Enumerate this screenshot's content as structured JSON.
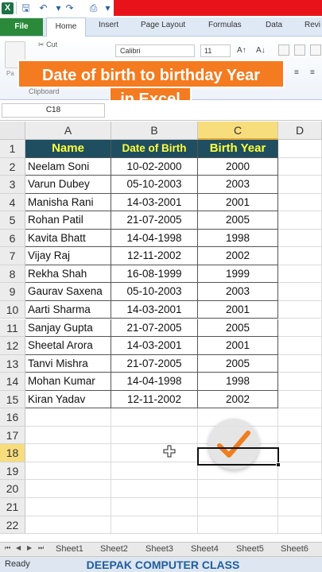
{
  "ribbon": {
    "tabs": [
      "File",
      "Home",
      "Insert",
      "Page Layout",
      "Formulas",
      "Data",
      "Revi"
    ],
    "cut_label": "Cut",
    "font_name": "Calibri",
    "font_size": "11",
    "clipboard_label": "Clipboard",
    "paste_label": "Pa"
  },
  "overlay": {
    "line1": "Date of birth to birthday Year",
    "line2": "in Excel"
  },
  "formula_bar": {
    "name_box": "C18"
  },
  "grid": {
    "columns": [
      "A",
      "B",
      "C",
      "D"
    ],
    "rows": [
      "1",
      "2",
      "3",
      "4",
      "5",
      "6",
      "7",
      "8",
      "9",
      "10",
      "11",
      "12",
      "13",
      "14",
      "15",
      "16",
      "17",
      "18",
      "19",
      "20",
      "21",
      "22"
    ],
    "headers": [
      "Name",
      "Date of Birth",
      "Birth Year"
    ],
    "data": [
      [
        "Neelam Soni",
        "10-02-2000",
        "2000"
      ],
      [
        "Varun Dubey",
        "05-10-2003",
        "2003"
      ],
      [
        "Manisha Rani",
        "14-03-2001",
        "2001"
      ],
      [
        "Rohan Patil",
        "21-07-2005",
        "2005"
      ],
      [
        "Kavita Bhatt",
        "14-04-1998",
        "1998"
      ],
      [
        "Vijay Raj",
        "12-11-2002",
        "2002"
      ],
      [
        "Rekha Shah",
        "16-08-1999",
        "1999"
      ],
      [
        "Gaurav Saxena",
        "05-10-2003",
        "2003"
      ],
      [
        "Aarti Sharma",
        "14-03-2001",
        "2001"
      ],
      [
        "Sanjay Gupta",
        "21-07-2005",
        "2005"
      ],
      [
        "Sheetal Arora",
        "14-03-2001",
        "2001"
      ],
      [
        "Tanvi Mishra",
        "21-07-2005",
        "2005"
      ],
      [
        "Mohan Kumar",
        "14-04-1998",
        "1998"
      ],
      [
        "Kiran Yadav",
        "12-11-2002",
        "2002"
      ]
    ],
    "selected_column": "C",
    "selected_row": "18"
  },
  "sheets": [
    "Sheet1",
    "Sheet2",
    "Sheet3",
    "Sheet4",
    "Sheet5",
    "Sheet6"
  ],
  "status": {
    "ready": "Ready",
    "credit": "DEEPAK COMPUTER CLASS"
  },
  "colors": {
    "header_fill": "#1f4e61",
    "header_text": "#ffff3a",
    "banner": "#f47b20",
    "file_tab": "#2a8a3a"
  }
}
